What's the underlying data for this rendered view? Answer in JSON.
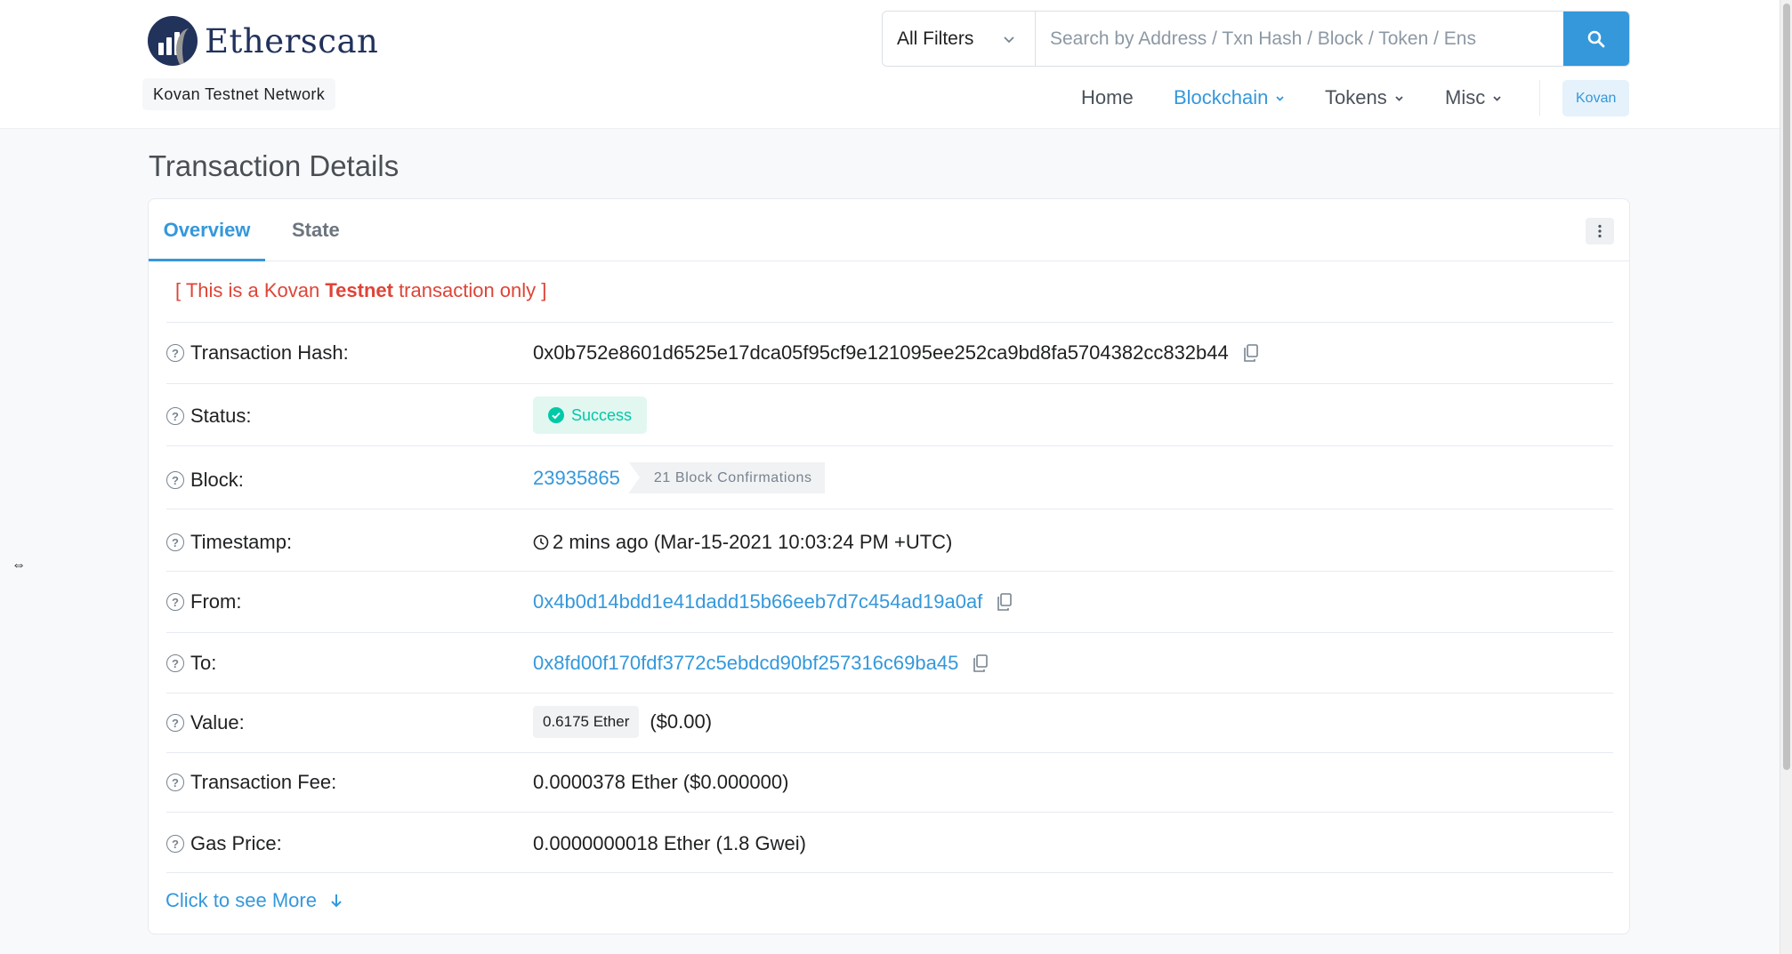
{
  "header": {
    "logo_text": "Etherscan",
    "network_badge": "Kovan Testnet Network",
    "filter": {
      "selected": "All Filters"
    },
    "search": {
      "placeholder": "Search by Address / Txn Hash / Block / Token / Ens"
    },
    "nav": {
      "home": "Home",
      "blockchain": "Blockchain",
      "tokens": "Tokens",
      "misc": "Misc",
      "network": "Kovan"
    }
  },
  "page": {
    "title": "Transaction Details"
  },
  "tabs": {
    "overview": "Overview",
    "state": "State"
  },
  "notice": {
    "prefix": "[ This is a Kovan ",
    "emphasis": "Testnet",
    "suffix": " transaction only ]"
  },
  "rows": {
    "hash": {
      "label": "Transaction Hash:",
      "value": "0x0b752e8601d6525e17dca05f95cf9e121095ee252ca9bd8fa5704382cc832b44"
    },
    "status": {
      "label": "Status:",
      "value": "Success"
    },
    "block": {
      "label": "Block:",
      "value": "23935865",
      "confirmations": "21 Block Confirmations"
    },
    "timestamp": {
      "label": "Timestamp:",
      "value": "2 mins ago (Mar-15-2021 10:03:24 PM +UTC)"
    },
    "from": {
      "label": "From:",
      "value": "0x4b0d14bdd1e41dadd15b66eeb7d7c454ad19a0af"
    },
    "to": {
      "label": "To:",
      "value": "0x8fd00f170fdf3772c5ebdcd90bf257316c69ba45"
    },
    "value": {
      "label": "Value:",
      "amount": "0.6175 Ether",
      "usd": "($0.00)"
    },
    "fee": {
      "label": "Transaction Fee:",
      "value": "0.0000378 Ether ($0.000000)"
    },
    "gas": {
      "label": "Gas Price:",
      "value": "0.0000000018 Ether (1.8 Gwei)"
    }
  },
  "see_more": "Click to see More",
  "colors": {
    "accent": "#3498db",
    "success": "#00c9a7",
    "danger": "#de4437",
    "brand": "#21325b"
  }
}
